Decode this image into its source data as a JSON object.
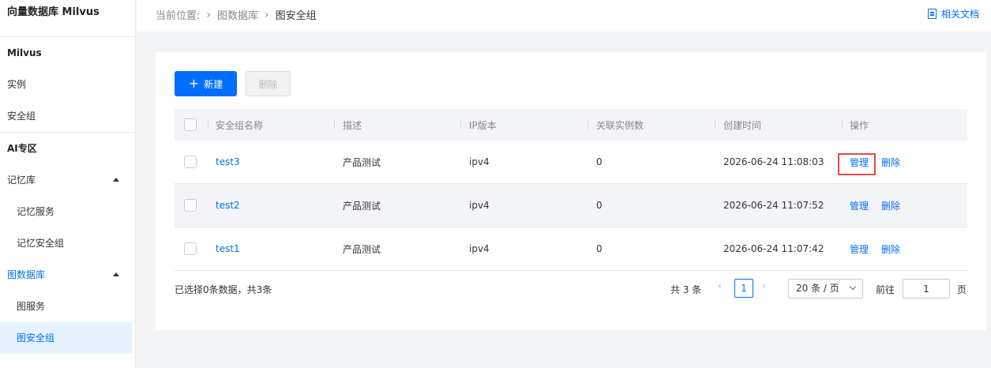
{
  "sidebar": {
    "brand": "向量数据库 Milvus",
    "section1": "Milvus",
    "instances": "实例",
    "security_group": "安全组",
    "section2": "AI专区",
    "memory_lib": "记忆库",
    "memory_service": "记忆服务",
    "memory_sg": "记忆安全组",
    "graph_db": "图数据库",
    "graph_service": "图服务",
    "graph_sg": "图安全组"
  },
  "header": {
    "location_label": "当前位置:",
    "crumb1": "图数据库",
    "crumb2": "图安全组",
    "doc_link": "相关文档"
  },
  "toolbar": {
    "new_label": "新建",
    "delete_label": "删除"
  },
  "table": {
    "columns": [
      "安全组名称",
      "描述",
      "IP版本",
      "关联实例数",
      "创建时间",
      "操作"
    ],
    "rows": [
      {
        "name": "test3",
        "desc": "产品测试",
        "ip": "ipv4",
        "count": "0",
        "created": "2026-06-24 11:08:03",
        "manage": "管理",
        "delete": "删除"
      },
      {
        "name": "test2",
        "desc": "产品测试",
        "ip": "ipv4",
        "count": "0",
        "created": "2026-06-24 11:07:52",
        "manage": "管理",
        "delete": "删除"
      },
      {
        "name": "test1",
        "desc": "产品测试",
        "ip": "ipv4",
        "count": "0",
        "created": "2026-06-24 11:07:42",
        "manage": "管理",
        "delete": "删除"
      }
    ]
  },
  "footer": {
    "selected_text": "已选择0条数据，共3条",
    "total_text": "共 3 条",
    "current_page": "1",
    "page_size": "20 条 / 页",
    "goto_label": "前往",
    "goto_value": "1",
    "page_unit": "页"
  },
  "colors": {
    "primary": "#006eff",
    "highlight": "#e04b4b"
  }
}
